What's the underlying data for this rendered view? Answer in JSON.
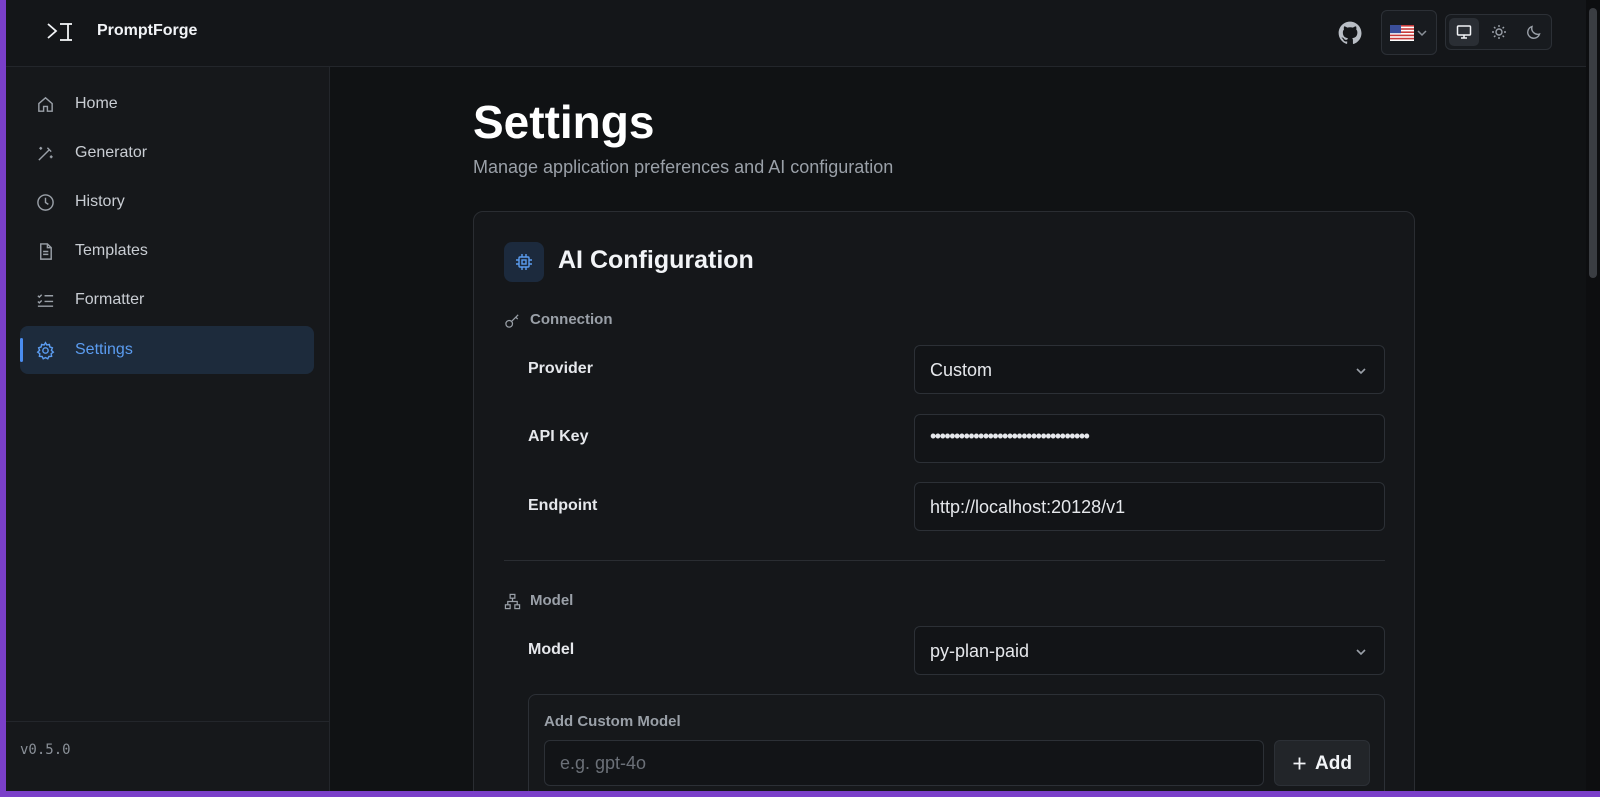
{
  "app": {
    "brand": "PromptForge",
    "version": "v0.5.0"
  },
  "sidebar": {
    "items": [
      {
        "label": "Home",
        "icon": "home-icon"
      },
      {
        "label": "Generator",
        "icon": "wand-icon"
      },
      {
        "label": "History",
        "icon": "clock-icon"
      },
      {
        "label": "Templates",
        "icon": "document-icon"
      },
      {
        "label": "Formatter",
        "icon": "list-check-icon"
      },
      {
        "label": "Settings",
        "icon": "gear-icon",
        "active": true
      }
    ]
  },
  "page": {
    "title": "Settings",
    "subtitle": "Manage application preferences and AI configuration"
  },
  "ai_config": {
    "title": "AI Configuration",
    "connection": {
      "heading": "Connection",
      "provider_label": "Provider",
      "provider_value": "Custom",
      "api_key_label": "API Key",
      "api_key_value": "•••••••••••••••••••••••••••••••••",
      "endpoint_label": "Endpoint",
      "endpoint_value": "http://localhost:20128/v1"
    },
    "model": {
      "heading": "Model",
      "model_label": "Model",
      "model_value": "py-plan-paid",
      "custom_label": "Add Custom Model",
      "custom_placeholder": "e.g. gpt-4o",
      "add_label": "Add"
    }
  },
  "colors": {
    "accent": "#4a8df0",
    "background": "#121417",
    "frame": "#7a3fc9"
  }
}
